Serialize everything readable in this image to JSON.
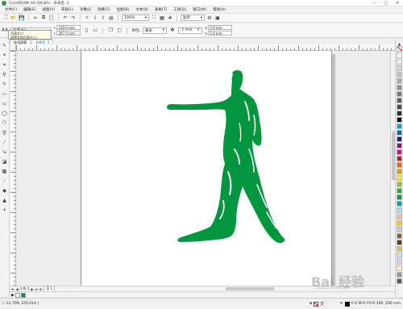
{
  "app": {
    "title": "CorelDRAW X8 (64-Bit) - 未命名 -1"
  },
  "window_buttons": {
    "minimize": "—",
    "maximize": "□",
    "close": "✕"
  },
  "menu": {
    "items": [
      "文件(F)",
      "编辑(E)",
      "视图(V)",
      "布局(L)",
      "对象(J)",
      "效果(C)",
      "位图(B)",
      "文本(X)",
      "表格(T)",
      "工具(O)",
      "窗口(W)",
      "帮助(H)"
    ]
  },
  "standard_toolbar": {
    "zoom": "100%",
    "snap": "贴齐"
  },
  "property_bar": {
    "page_size": "页面大小",
    "width": "210.0 mm",
    "height": "297.0 mm",
    "units_label": "单位:",
    "units_value": "毫米",
    "nudge": ".1 mm",
    "dup_x": "5.0 mm",
    "dup_y": "5.0 mm"
  },
  "tooltip": {
    "line1": "页面大小",
    "line2": "选择文档页面大小。"
  },
  "doc_tabs": [
    "欢迎屏幕",
    "未命名 -1"
  ],
  "page_nav": {
    "counter": "1 的 1",
    "page_tab": "页 1"
  },
  "status_bar": {
    "coords": "( -12,709, 255,014 )",
    "fill_label": "无",
    "color_info": "C:0 M:0 Y:0 K:100 .200 mm"
  },
  "watermark": {
    "text": "Bai 经验",
    "url": "jingyan.baidu.com"
  },
  "figure": {
    "fill_color": "#00963f"
  },
  "palette_colors": [
    "#ffffff",
    "#f0f0f0",
    "#d8d8d8",
    "#c0c0c0",
    "#a8a8a8",
    "#909090",
    "#787878",
    "#606060",
    "#484848",
    "#303030",
    "#000000",
    "#00a0e9",
    "#0068b7",
    "#1d2088",
    "#920783",
    "#e4007f",
    "#e60012",
    "#eb6100",
    "#f39800",
    "#fff100",
    "#8fc31f",
    "#22ac38",
    "#009944",
    "#009e96",
    "#a0d8ef",
    "#f5b2b2",
    "#fcc800",
    "#c9caca",
    "#8c6239",
    "#603813",
    "#d7c447",
    "#bde3f7",
    "#e5d0ec",
    "#faf0c8",
    "#9a9a9a",
    "#595757"
  ]
}
